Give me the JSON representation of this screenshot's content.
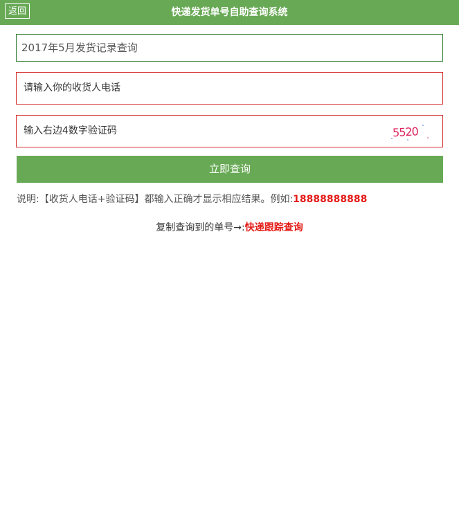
{
  "header": {
    "back_label": "返回",
    "title": "快递发货单号自助查询系统",
    "color": "#68a955"
  },
  "form": {
    "record_select": "2017年5月发货记录查询",
    "phone_placeholder": "请输入你的收货人电话",
    "code_placeholder": "输入右边4数字验证码",
    "captcha_text": "5520",
    "submit_label": "立即查询"
  },
  "note": {
    "text": "说明:【收货人电话+验证码】都输入正确才显示相应结果。例如:",
    "example": "18888888888"
  },
  "copy": {
    "text": "复制查询到的单号→:",
    "link": "快递跟踪查询"
  },
  "colors": {
    "accent_green": "#68a955",
    "alert_red": "#e41b17"
  }
}
